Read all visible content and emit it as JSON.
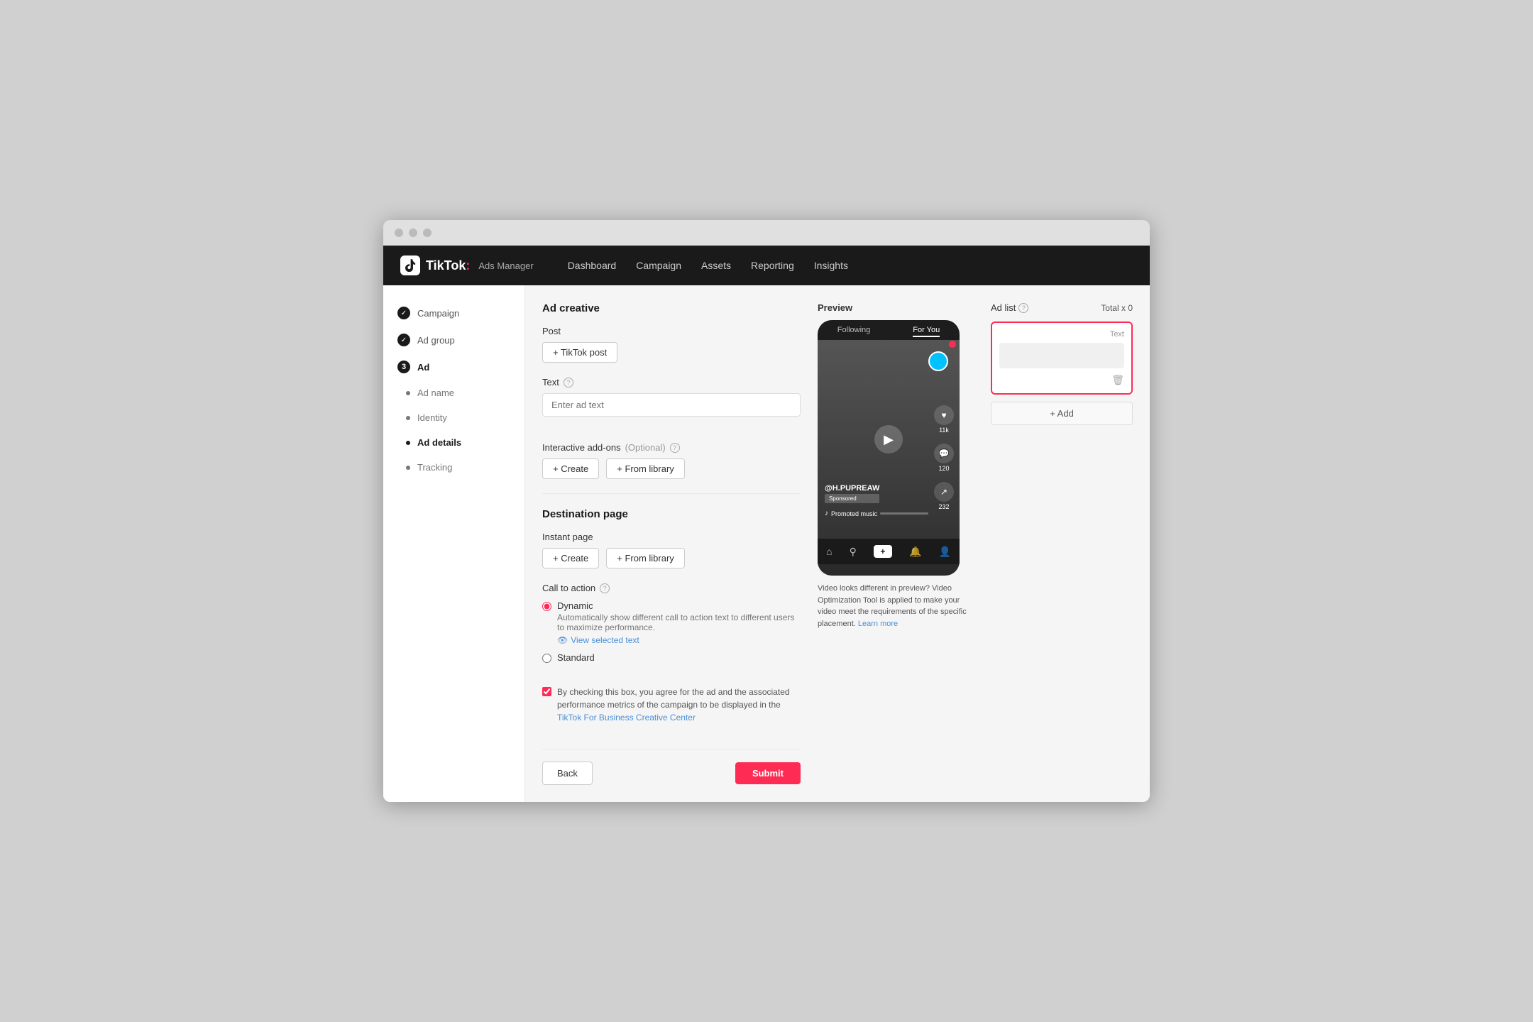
{
  "browser": {
    "dots": [
      "dot1",
      "dot2",
      "dot3"
    ]
  },
  "nav": {
    "logo": "TikTok",
    "colon": ":",
    "adsManager": "Ads Manager",
    "items": [
      {
        "label": "Dashboard",
        "key": "dashboard"
      },
      {
        "label": "Campaign",
        "key": "campaign"
      },
      {
        "label": "Assets",
        "key": "assets"
      },
      {
        "label": "Reporting",
        "key": "reporting"
      },
      {
        "label": "Insights",
        "key": "insights"
      }
    ]
  },
  "sidebar": {
    "items": [
      {
        "type": "check",
        "label": "Campaign",
        "key": "campaign"
      },
      {
        "type": "check",
        "label": "Ad group",
        "key": "ad-group"
      },
      {
        "type": "number",
        "label": "Ad",
        "key": "ad",
        "number": "3"
      },
      {
        "type": "dot",
        "label": "Ad name",
        "key": "ad-name"
      },
      {
        "type": "dot",
        "label": "Identity",
        "key": "identity"
      },
      {
        "type": "bullet-active",
        "label": "Ad details",
        "key": "ad-details"
      },
      {
        "type": "dot",
        "label": "Tracking",
        "key": "tracking"
      }
    ]
  },
  "form": {
    "section_title": "Ad creative",
    "post_label": "Post",
    "post_button": "+ TikTok post",
    "text_label": "Text",
    "text_placeholder": "Enter ad text",
    "interactive_label": "Interactive add-ons",
    "interactive_optional": "(Optional)",
    "create_button": "+ Create",
    "from_library_button_1": "+ From library",
    "destination_label": "Destination page",
    "instant_page_label": "Instant page",
    "from_library_button_2": "+ From library",
    "cta_label": "Call to action",
    "dynamic_label": "Dynamic",
    "dynamic_desc": "Automatically show different call to action text to different users to maximize performance.",
    "view_selected_text": "View selected text",
    "standard_label": "Standard",
    "checkbox_text_1": "By checking this box, you agree for the ad and the associated performance metrics of the campaign to be displayed in the ",
    "checkbox_link": "TikTok For Business Creative Center",
    "back_button": "Back",
    "submit_button": "Submit"
  },
  "preview": {
    "label": "Preview",
    "following": "Following",
    "for_you": "For You",
    "username": "@H.PUPREAW",
    "music_text": "Promoted music",
    "preview_note": "Video looks different in preview? Video Optimization Tool is applied to make your video meet the requirements of the specific placement.",
    "learn_more": "Learn more",
    "bottom_nav": [
      "🏠",
      "🔍",
      "+",
      "🔔",
      "👤"
    ],
    "side_actions": [
      {
        "icon": "♥",
        "count": "11k"
      },
      {
        "icon": "💬",
        "count": "120"
      },
      {
        "icon": "↗",
        "count": "232"
      }
    ]
  },
  "ad_list": {
    "title": "Ad list",
    "total": "Total x 0",
    "text_label": "Text",
    "add_button": "+ Add"
  }
}
